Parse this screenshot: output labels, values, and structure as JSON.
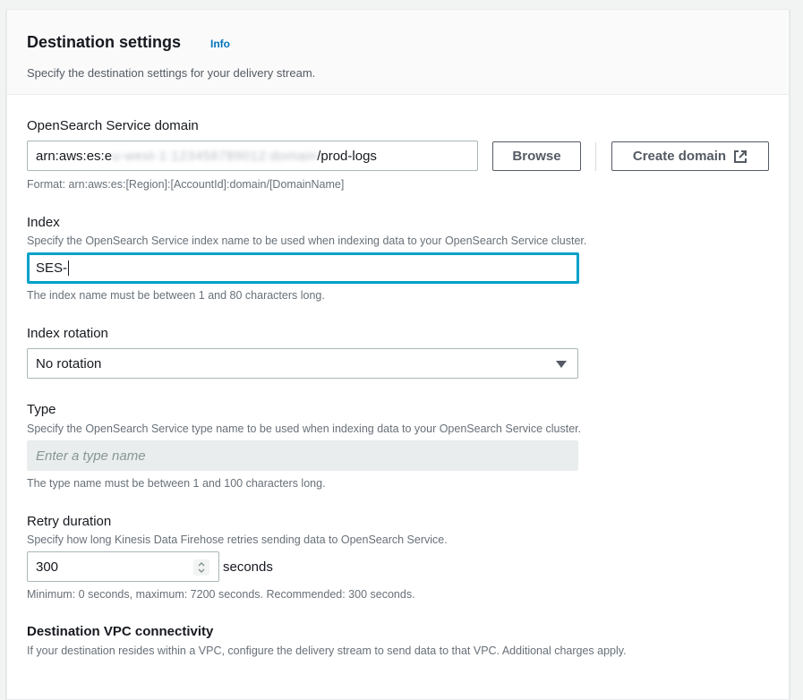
{
  "section": {
    "title": "Destination settings",
    "info_link": "Info",
    "description": "Specify the destination settings for your delivery stream."
  },
  "domain": {
    "label": "OpenSearch Service domain",
    "value_prefix": "arn:aws:es:e",
    "value_redacted": "u-west-1:123456789012:domain",
    "value_suffix": "/prod-logs",
    "browse_button": "Browse",
    "create_button": "Create domain",
    "create_icon": "external-link-icon",
    "format_hint": "Format: arn:aws:es:[Region]:[AccountId]:domain/[DomainName]"
  },
  "index": {
    "label": "Index",
    "description": "Specify the OpenSearch Service index name to be used when indexing data to your OpenSearch Service cluster.",
    "value": "SES-",
    "constraint": "The index name must be between 1 and 80 characters long."
  },
  "index_rotation": {
    "label": "Index rotation",
    "selected": "No rotation"
  },
  "type": {
    "label": "Type",
    "description": "Specify the OpenSearch Service type name to be used when indexing data to your OpenSearch Service cluster.",
    "placeholder": "Enter a type name",
    "constraint": "The type name must be between 1 and 100 characters long."
  },
  "retry": {
    "label": "Retry duration",
    "description": "Specify how long Kinesis Data Firehose retries sending data to OpenSearch Service.",
    "value": "300",
    "unit": "seconds",
    "constraint": "Minimum: 0 seconds, maximum: 7200 seconds. Recommended: 300 seconds."
  },
  "vpc": {
    "label": "Destination VPC connectivity",
    "description": "If your destination resides within a VPC, configure the delivery stream to send data to that VPC. Additional charges apply."
  },
  "colors": {
    "link": "#0073bb",
    "focus": "#00a1c9",
    "text": "#16191f",
    "muted": "#687078"
  }
}
